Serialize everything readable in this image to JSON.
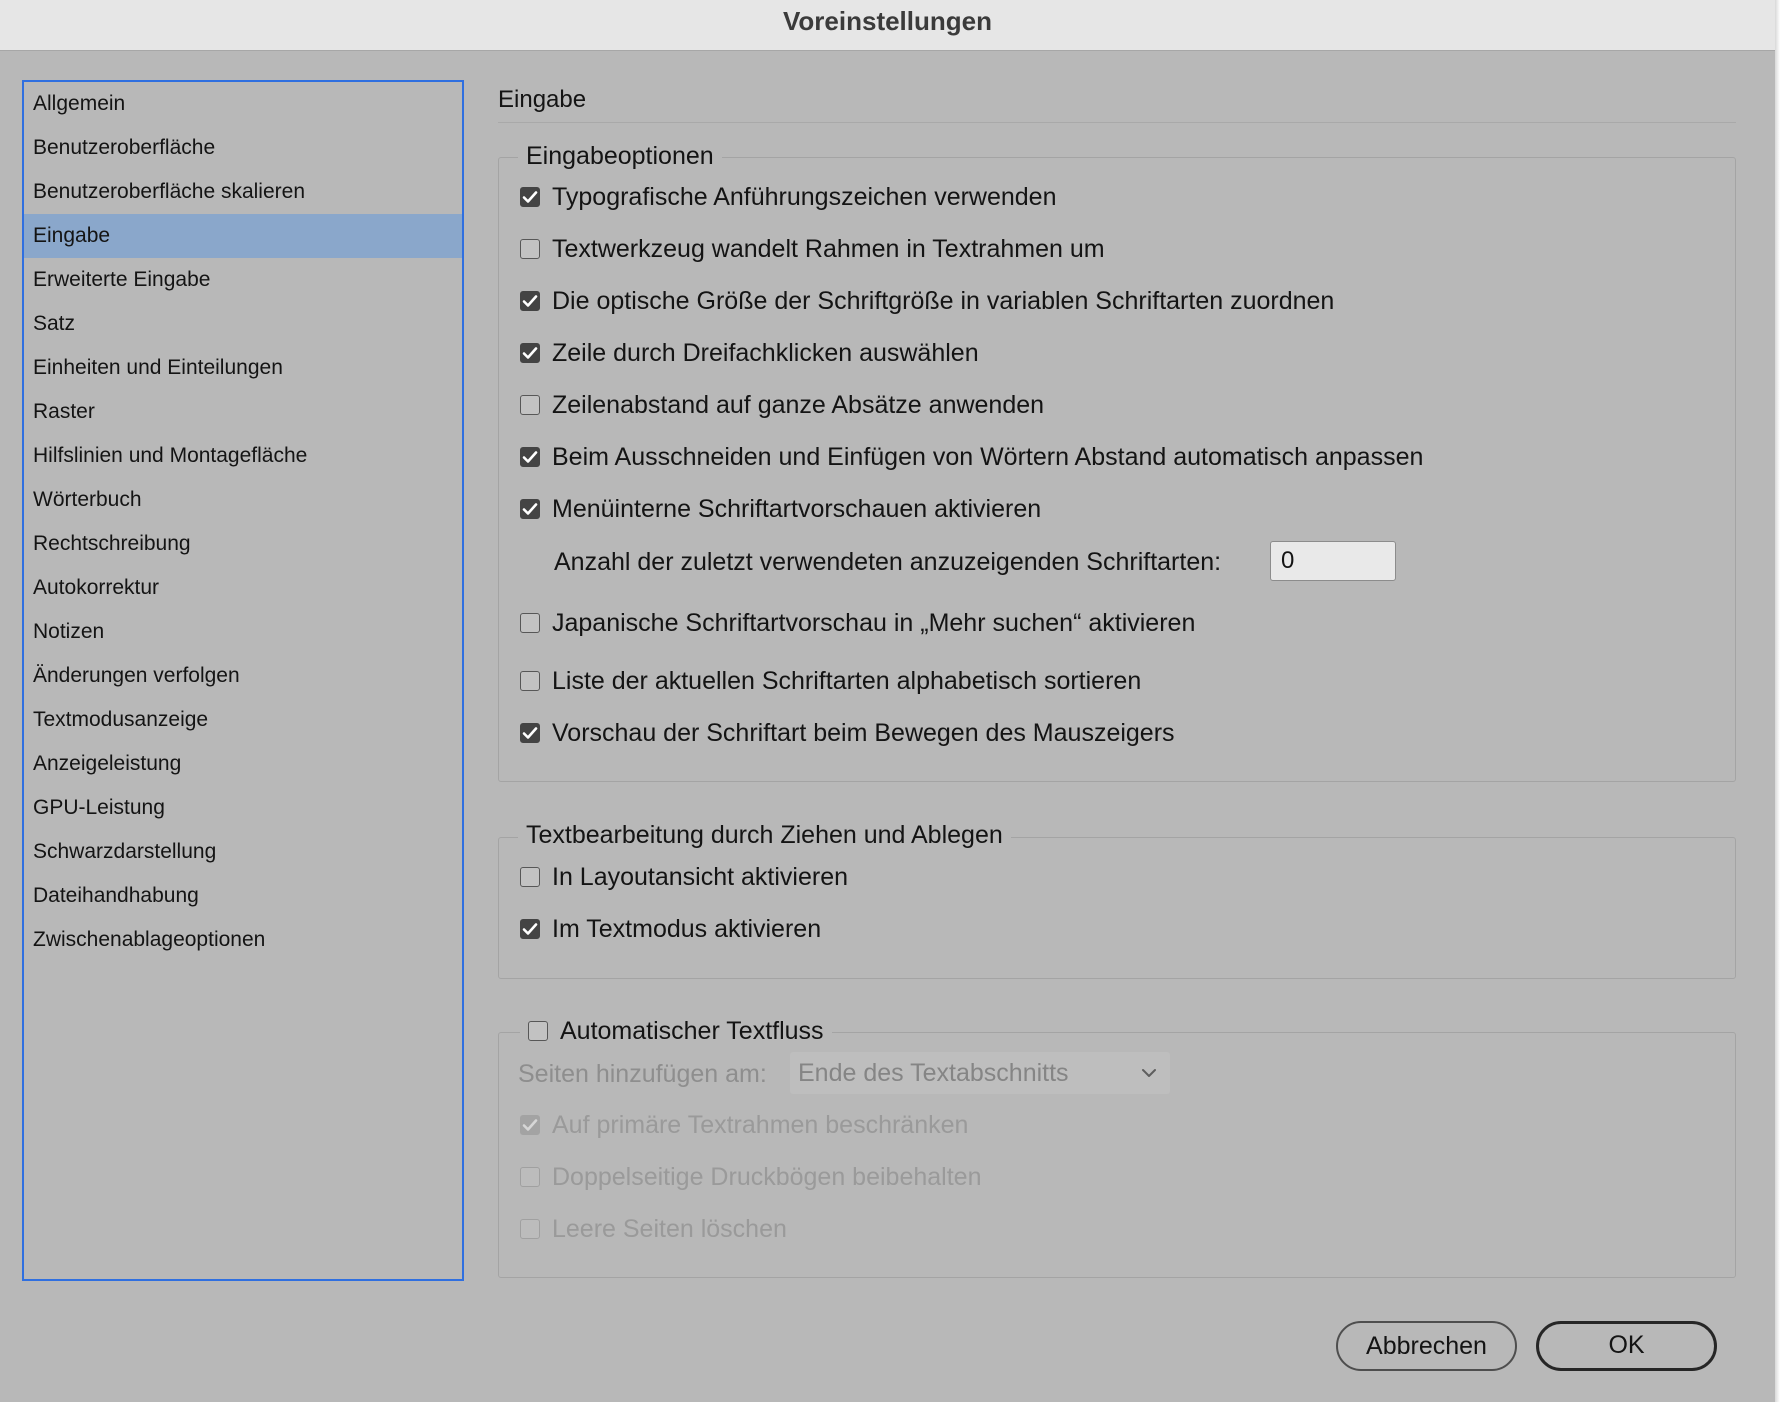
{
  "window": {
    "title": "Voreinstellungen"
  },
  "sidebar": {
    "items": [
      {
        "label": "Allgemein",
        "selected": false
      },
      {
        "label": "Benutzeroberfläche",
        "selected": false
      },
      {
        "label": "Benutzeroberfläche skalieren",
        "selected": false
      },
      {
        "label": "Eingabe",
        "selected": true
      },
      {
        "label": "Erweiterte Eingabe",
        "selected": false
      },
      {
        "label": "Satz",
        "selected": false
      },
      {
        "label": "Einheiten und Einteilungen",
        "selected": false
      },
      {
        "label": "Raster",
        "selected": false
      },
      {
        "label": "Hilfslinien und Montagefläche",
        "selected": false
      },
      {
        "label": "Wörterbuch",
        "selected": false
      },
      {
        "label": "Rechtschreibung",
        "selected": false
      },
      {
        "label": "Autokorrektur",
        "selected": false
      },
      {
        "label": "Notizen",
        "selected": false
      },
      {
        "label": "Änderungen verfolgen",
        "selected": false
      },
      {
        "label": "Textmodusanzeige",
        "selected": false
      },
      {
        "label": "Anzeigeleistung",
        "selected": false
      },
      {
        "label": "GPU-Leistung",
        "selected": false
      },
      {
        "label": "Schwarzdarstellung",
        "selected": false
      },
      {
        "label": "Dateihandhabung",
        "selected": false
      },
      {
        "label": "Zwischenablageoptionen",
        "selected": false
      }
    ]
  },
  "main": {
    "title": "Eingabe",
    "input_options": {
      "legend": "Eingabeoptionen",
      "options": [
        {
          "label": "Typografische Anführungszeichen verwenden",
          "checked": true
        },
        {
          "label": "Textwerkzeug wandelt Rahmen in Textrahmen um",
          "checked": false
        },
        {
          "label": "Die optische Größe der Schriftgröße in variablen Schriftarten zuordnen",
          "checked": true
        },
        {
          "label": "Zeile durch Dreifachklicken auswählen",
          "checked": true
        },
        {
          "label": "Zeilenabstand auf ganze Absätze anwenden",
          "checked": false
        },
        {
          "label": "Beim Ausschneiden und Einfügen von Wörtern Abstand automatisch anpassen",
          "checked": true
        },
        {
          "label": "Menüinterne Schriftartvorschauen aktivieren",
          "checked": true
        }
      ],
      "recent_fonts_label": "Anzahl der zuletzt verwendeten anzuzeigenden Schriftarten:",
      "recent_fonts_value": "0",
      "options_after": [
        {
          "label": "Japanische Schriftartvorschau in „Mehr suchen“ aktivieren",
          "checked": false
        },
        {
          "label": "Liste der aktuellen Schriftarten alphabetisch sortieren",
          "checked": false
        },
        {
          "label": "Vorschau der Schriftart beim Bewegen des Mauszeigers",
          "checked": true
        }
      ]
    },
    "drag_drop": {
      "legend": "Textbearbeitung durch Ziehen und Ablegen",
      "options": [
        {
          "label": "In Layoutansicht aktivieren",
          "checked": false
        },
        {
          "label": "Im Textmodus aktivieren",
          "checked": true
        }
      ]
    },
    "smart_reflow": {
      "legend": "Automatischer Textfluss",
      "checked": false,
      "add_pages_label": "Seiten hinzufügen am:",
      "add_pages_value": "Ende des Textabschnitts",
      "options": [
        {
          "label": "Auf primäre Textrahmen beschränken",
          "checked": true,
          "disabled": true
        },
        {
          "label": "Doppelseitige Druckbögen beibehalten",
          "checked": false,
          "disabled": true
        },
        {
          "label": "Leere Seiten löschen",
          "checked": false,
          "disabled": true
        }
      ]
    }
  },
  "buttons": {
    "cancel": "Abbrechen",
    "ok": "OK"
  }
}
